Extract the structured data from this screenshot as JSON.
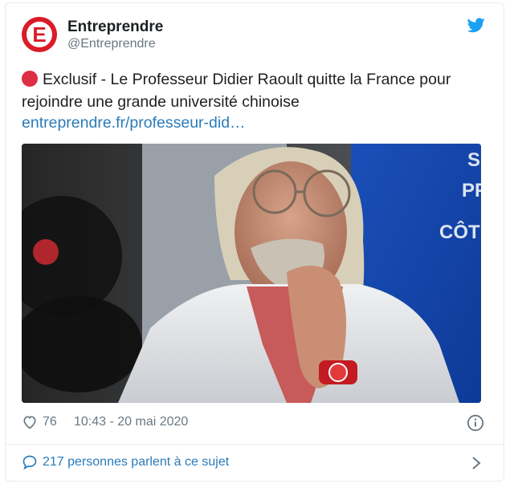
{
  "tweet": {
    "author": {
      "display_name": "Entreprendre",
      "handle": "@Entreprendre",
      "avatar_letter": "E"
    },
    "text": "Exclusif - Le Professeur Didier Raoult quitte la France pour rejoindre une grande université chinoise",
    "link": "entreprendre.fr/professeur-did…",
    "media": {
      "background_text": [
        "S",
        "PF",
        "CÔT"
      ]
    },
    "likes": "76",
    "timestamp": "10:43 - 20 mai 2020",
    "conversation_label": "217 personnes parlent à ce sujet"
  },
  "icons": {
    "twitter": "twitter-bird-icon",
    "emoji": "red-circle-emoji",
    "heart": "heart-icon",
    "info": "info-icon",
    "chat": "chat-bubble-icon",
    "chevron": "chevron-right-icon"
  },
  "colors": {
    "brand_red": "#d91c27",
    "twitter_blue": "#1da1f2",
    "link_blue": "#2b7bb9",
    "muted_gray": "#697882",
    "red_dot": "#dd2e44"
  }
}
